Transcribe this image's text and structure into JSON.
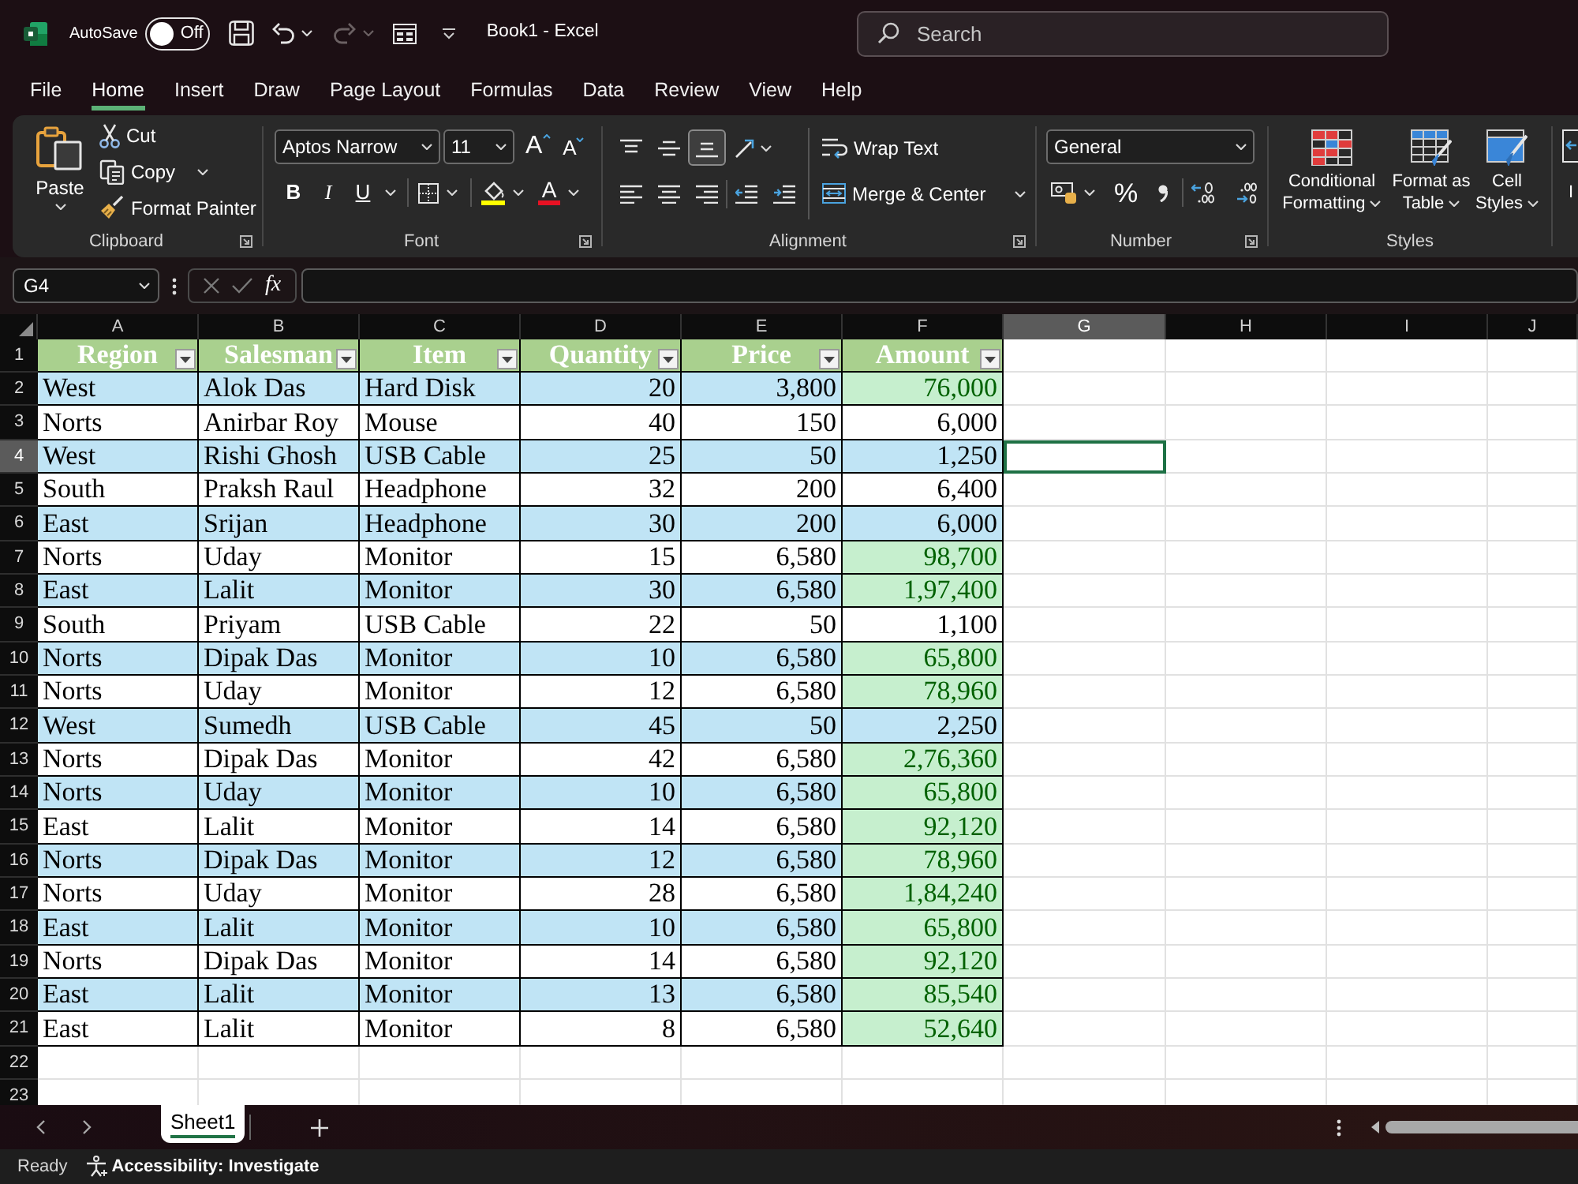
{
  "title_bar": {
    "autosave_label": "AutoSave",
    "autosave": {
      "on": false,
      "label": "Off"
    },
    "redo": {
      "disabled": true
    },
    "title": "Book1 - Excel",
    "search": {
      "placeholder": "Search"
    }
  },
  "tabs": [
    {
      "label": "File",
      "selected": false
    },
    {
      "label": "Home",
      "selected": true
    },
    {
      "label": "Insert",
      "selected": false
    },
    {
      "label": "Draw",
      "selected": false
    },
    {
      "label": "Page Layout",
      "selected": false
    },
    {
      "label": "Formulas",
      "selected": false
    },
    {
      "label": "Data",
      "selected": false
    },
    {
      "label": "Review",
      "selected": false
    },
    {
      "label": "View",
      "selected": false
    },
    {
      "label": "Help",
      "selected": false
    }
  ],
  "ribbon": {
    "clipboard": {
      "label": "Clipboard",
      "paste": "Paste",
      "cut": "Cut",
      "copy": "Copy",
      "format_painter": "Format Painter"
    },
    "font": {
      "label": "Font",
      "font_name": "Aptos Narrow",
      "font_size": "11",
      "grow": "A",
      "shrink": "A",
      "bold": "B",
      "italic": "I",
      "underline": "U",
      "font_color": "A"
    },
    "alignment": {
      "label": "Alignment",
      "vertical_align": [
        {
          "kind": "top",
          "selected": false
        },
        {
          "kind": "middle",
          "selected": false
        },
        {
          "kind": "bottom",
          "selected": true
        }
      ],
      "wrap_text": "Wrap Text",
      "merge_center": "Merge & Center"
    },
    "number": {
      "label": "Number",
      "format": "General",
      "percent": "%"
    },
    "styles": {
      "label": "Styles",
      "buttons": [
        {
          "kind": "conditional",
          "label": "Conditional Formatting"
        },
        {
          "kind": "table",
          "label": "Format as Table"
        },
        {
          "kind": "cell",
          "label": "Cell Styles"
        }
      ]
    },
    "next_group": {
      "label": "I"
    }
  },
  "formula_bar": {
    "name_box": "G4",
    "cancel": {
      "disabled": true
    },
    "enter": {
      "disabled": true
    },
    "function": "fx"
  },
  "column_headers": [
    {
      "label": "A",
      "selected": false
    },
    {
      "label": "B",
      "selected": false
    },
    {
      "label": "C",
      "selected": false
    },
    {
      "label": "D",
      "selected": false
    },
    {
      "label": "E",
      "selected": false
    },
    {
      "label": "F",
      "selected": false
    },
    {
      "label": "G",
      "selected": true
    },
    {
      "label": "H",
      "selected": false
    },
    {
      "label": "I",
      "selected": false
    },
    {
      "label": "J",
      "selected": false
    }
  ],
  "row_headers": [
    {
      "label": "1",
      "selected": false
    },
    {
      "label": "2",
      "selected": false
    },
    {
      "label": "3",
      "selected": false
    },
    {
      "label": "4",
      "selected": true
    },
    {
      "label": "5",
      "selected": false
    },
    {
      "label": "6",
      "selected": false
    },
    {
      "label": "7",
      "selected": false
    },
    {
      "label": "8",
      "selected": false
    },
    {
      "label": "9",
      "selected": false
    },
    {
      "label": "10",
      "selected": false
    },
    {
      "label": "11",
      "selected": false
    },
    {
      "label": "12",
      "selected": false
    },
    {
      "label": "13",
      "selected": false
    },
    {
      "label": "14",
      "selected": false
    },
    {
      "label": "15",
      "selected": false
    },
    {
      "label": "16",
      "selected": false
    },
    {
      "label": "17",
      "selected": false
    },
    {
      "label": "18",
      "selected": false
    },
    {
      "label": "19",
      "selected": false
    },
    {
      "label": "20",
      "selected": false
    },
    {
      "label": "21",
      "selected": false
    },
    {
      "label": "22",
      "selected": false
    },
    {
      "label": "23",
      "selected": false
    }
  ],
  "table": {
    "columns": [
      {
        "label": "Region",
        "kind": "text",
        "filter": true,
        "conditional_format": false
      },
      {
        "label": "Salesman",
        "kind": "text",
        "filter": true,
        "conditional_format": false
      },
      {
        "label": "Item",
        "kind": "text",
        "filter": true,
        "conditional_format": false
      },
      {
        "label": "Quantity",
        "kind": "number",
        "filter": true,
        "conditional_format": false
      },
      {
        "label": "Price",
        "kind": "number",
        "filter": true,
        "conditional_format": false
      },
      {
        "label": "Amount",
        "kind": "number",
        "filter": true,
        "conditional_format": true
      }
    ],
    "rows": [
      {
        "cells": [
          "West",
          "Alok Das",
          "Hard Disk",
          "20",
          "3,800",
          "76,000"
        ],
        "band": true,
        "highlight": true
      },
      {
        "cells": [
          "Norts",
          "Anirbar Roy",
          "Mouse",
          "40",
          "150",
          "6,000"
        ],
        "band": false,
        "highlight": false
      },
      {
        "cells": [
          "West",
          "Rishi Ghosh",
          "USB Cable",
          "25",
          "50",
          "1,250"
        ],
        "band": true,
        "highlight": false
      },
      {
        "cells": [
          "South",
          "Praksh Raul",
          "Headphone",
          "32",
          "200",
          "6,400"
        ],
        "band": false,
        "highlight": false
      },
      {
        "cells": [
          "East",
          "Srijan",
          "Headphone",
          "30",
          "200",
          "6,000"
        ],
        "band": true,
        "highlight": false
      },
      {
        "cells": [
          "Norts",
          "Uday",
          "Monitor",
          "15",
          "6,580",
          "98,700"
        ],
        "band": false,
        "highlight": true
      },
      {
        "cells": [
          "East",
          "Lalit",
          "Monitor",
          "30",
          "6,580",
          "1,97,400"
        ],
        "band": true,
        "highlight": true
      },
      {
        "cells": [
          "South",
          "Priyam",
          "USB Cable",
          "22",
          "50",
          "1,100"
        ],
        "band": false,
        "highlight": false
      },
      {
        "cells": [
          "Norts",
          "Dipak Das",
          "Monitor",
          "10",
          "6,580",
          "65,800"
        ],
        "band": true,
        "highlight": true
      },
      {
        "cells": [
          "Norts",
          "Uday",
          "Monitor",
          "12",
          "6,580",
          "78,960"
        ],
        "band": false,
        "highlight": true
      },
      {
        "cells": [
          "West",
          "Sumedh",
          "USB Cable",
          "45",
          "50",
          "2,250"
        ],
        "band": true,
        "highlight": false
      },
      {
        "cells": [
          "Norts",
          "Dipak Das",
          "Monitor",
          "42",
          "6,580",
          "2,76,360"
        ],
        "band": false,
        "highlight": true
      },
      {
        "cells": [
          "Norts",
          "Uday",
          "Monitor",
          "10",
          "6,580",
          "65,800"
        ],
        "band": true,
        "highlight": true
      },
      {
        "cells": [
          "East",
          "Lalit",
          "Monitor",
          "14",
          "6,580",
          "92,120"
        ],
        "band": false,
        "highlight": true
      },
      {
        "cells": [
          "Norts",
          "Dipak Das",
          "Monitor",
          "12",
          "6,580",
          "78,960"
        ],
        "band": true,
        "highlight": true
      },
      {
        "cells": [
          "Norts",
          "Uday",
          "Monitor",
          "28",
          "6,580",
          "1,84,240"
        ],
        "band": false,
        "highlight": true
      },
      {
        "cells": [
          "East",
          "Lalit",
          "Monitor",
          "10",
          "6,580",
          "65,800"
        ],
        "band": true,
        "highlight": true
      },
      {
        "cells": [
          "Norts",
          "Dipak Das",
          "Monitor",
          "14",
          "6,580",
          "92,120"
        ],
        "band": false,
        "highlight": true
      },
      {
        "cells": [
          "East",
          "Lalit",
          "Monitor",
          "13",
          "6,580",
          "85,540"
        ],
        "band": true,
        "highlight": true
      },
      {
        "cells": [
          "East",
          "Lalit",
          "Monitor",
          "8",
          "6,580",
          "52,640"
        ],
        "band": false,
        "highlight": true
      }
    ]
  },
  "sheet_tabs": [
    {
      "label": "Sheet1",
      "selected": true
    }
  ],
  "status_bar": {
    "mode": "Ready",
    "accessibility": "Accessibility: Investigate"
  }
}
